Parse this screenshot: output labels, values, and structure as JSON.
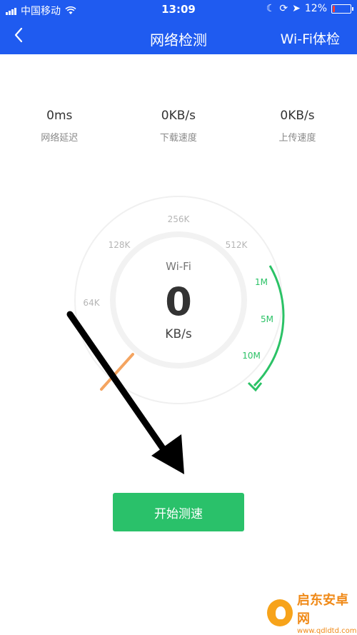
{
  "status_bar": {
    "carrier": "中国移动",
    "time": "13:09",
    "battery": "12%",
    "battery_level": 0.12
  },
  "nav": {
    "back_icon": "chevron-left-icon",
    "title": "网络检测",
    "right_label": "Wi-Fi体检"
  },
  "stats": [
    {
      "value": "0ms",
      "label": "网络延迟"
    },
    {
      "value": "0KB/s",
      "label": "下载速度"
    },
    {
      "value": "0KB/s",
      "label": "上传速度"
    }
  ],
  "gauge": {
    "ticks": [
      "64K",
      "128K",
      "256K",
      "512K",
      "1M",
      "5M",
      "10M"
    ],
    "active_ticks": [
      "1M",
      "5M",
      "10M"
    ],
    "network": "Wi-Fi",
    "speed": "0",
    "unit": "KB/s"
  },
  "start_button": "开始测速",
  "watermark": {
    "name": "启东安卓网",
    "url": "www.qdldtd.com"
  },
  "colors": {
    "header": "#1f5bf0",
    "accent": "#2ac16a",
    "arrow": "#000000"
  }
}
